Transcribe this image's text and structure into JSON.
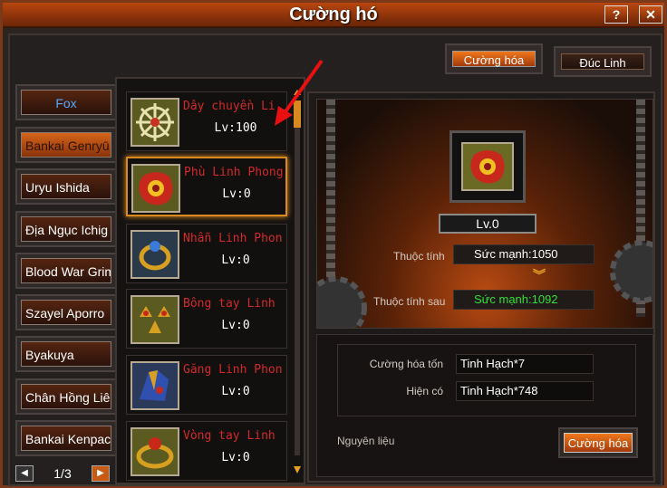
{
  "window": {
    "title": "Cường hó",
    "help_label": "?",
    "close_label": "✕"
  },
  "tabs": [
    {
      "label": "Cường hóa",
      "active": true
    },
    {
      "label": "Đúc Linh",
      "active": false
    }
  ],
  "characters": [
    {
      "label": "Fox"
    },
    {
      "label": "Bankai Genryū"
    },
    {
      "label": "Uryu Ishida"
    },
    {
      "label": "Địa Ngục Ichig"
    },
    {
      "label": "Blood War Grim"
    },
    {
      "label": "Szayel Aporro"
    },
    {
      "label": "Byakuya"
    },
    {
      "label": "Chân Hồng Liê"
    },
    {
      "label": "Bankai Kenpac"
    }
  ],
  "pager": {
    "text": "1/3",
    "prev_icon": "left-arrow-icon",
    "next_icon": "right-arrow-icon"
  },
  "items": [
    {
      "name": "Dây chuyền Li",
      "level": "Lv:100",
      "icon": "wheel-icon"
    },
    {
      "name": "Phù Linh Phong",
      "level": "Lv:0",
      "icon": "gear-blob-icon"
    },
    {
      "name": "Nhẫn Linh Phon",
      "level": "Lv:0",
      "icon": "ring-icon"
    },
    {
      "name": "Bông tay Linh",
      "level": "Lv:0",
      "icon": "earring-icon"
    },
    {
      "name": "Găng Linh Phon",
      "level": "Lv:0",
      "icon": "glove-icon"
    },
    {
      "name": "Vòng tay Linh",
      "level": "Lv:0",
      "icon": "bracelet-icon"
    }
  ],
  "detail": {
    "level": "Lv.0",
    "attr_label": "Thuộc tính",
    "attr_value": "Sức mạnh:1050",
    "attr_after_label": "Thuộc tính sau",
    "attr_after_value": "Sức mạnh:1092",
    "cost_label": "Cường hóa tốn",
    "cost_value": "Tinh Hạch*7",
    "have_label": "Hiện có",
    "have_value": "Tinh Hạch*748",
    "material_label": "Nguyên liệu",
    "action_label": "Cường hóa"
  },
  "colors": {
    "accent": "#e0701a",
    "item_name": "#d22a2a",
    "stat_after": "#30e030",
    "stat_normal": "#ffffff"
  }
}
